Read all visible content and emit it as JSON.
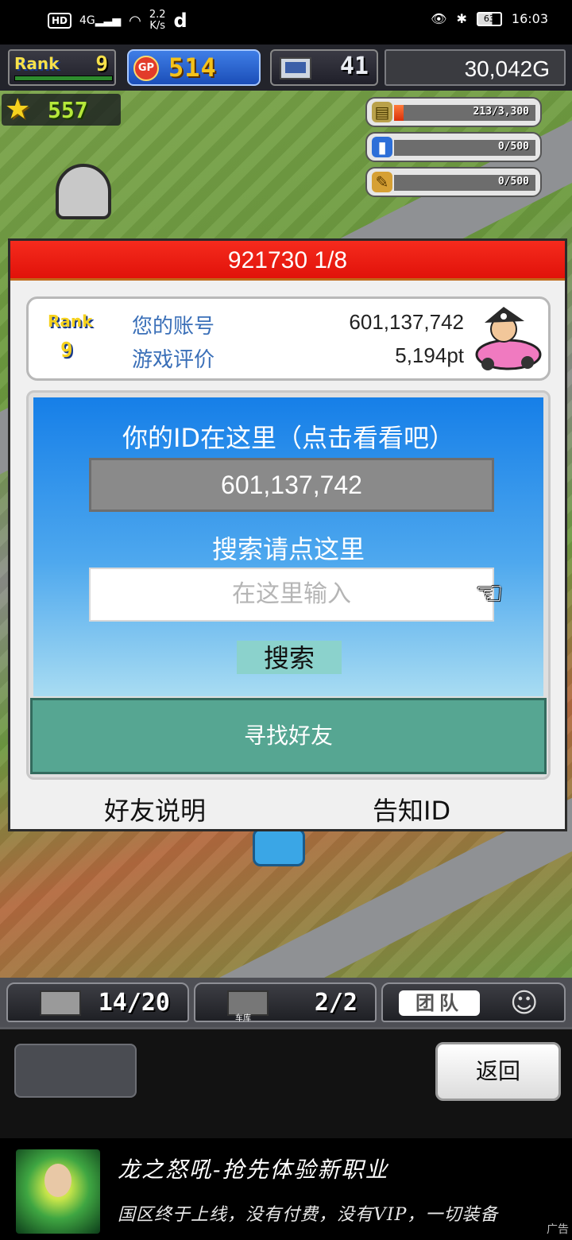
{
  "status_bar": {
    "hd": "HD",
    "signal": "4G",
    "net_speed": "2.2",
    "net_unit": "K/s",
    "app_glyph": "d",
    "battery": "63",
    "time": "16:03"
  },
  "hud": {
    "rank_label": "Rank",
    "rank_value": "9",
    "gp_badge": "GP",
    "gp_value": "514",
    "pc_value": "41",
    "money": "30,042G"
  },
  "world": {
    "stars_value": "557",
    "resources": [
      {
        "icon": "fuel-icon",
        "text": "213/3,300",
        "fill": 0.065
      },
      {
        "icon": "bottle-icon",
        "text": "0/500",
        "fill": 0
      },
      {
        "icon": "feather-icon",
        "text": "0/500",
        "fill": 0
      }
    ]
  },
  "modal": {
    "header": "921730 1/8",
    "account": {
      "rank_label": "Rank",
      "rank_value": "9",
      "id_label": "您的账号",
      "id_value": "601,137,742",
      "rating_label": "游戏评价",
      "rating_value": "5,194pt"
    },
    "panel": {
      "title": "你的ID在这里（点击看看吧）",
      "id_display": "601,137,742",
      "search_title": "搜索请点这里",
      "search_placeholder": "在这里输入",
      "search_button": "搜索",
      "find_friends": "寻找好友"
    },
    "links": {
      "friend_help": "好友说明",
      "share_id": "告知ID"
    }
  },
  "tabbar": {
    "tab1_value": "14/20",
    "tab2_caption": "车库",
    "tab2_value": "2/2",
    "tab3_label": "团队"
  },
  "bottom": {
    "back_button": "返回"
  },
  "ad": {
    "title": "龙之怒吼-抢先体验新职业",
    "desc": "国区终于上线，没有付费，没有VIP，一切装备",
    "tag": "广告"
  }
}
